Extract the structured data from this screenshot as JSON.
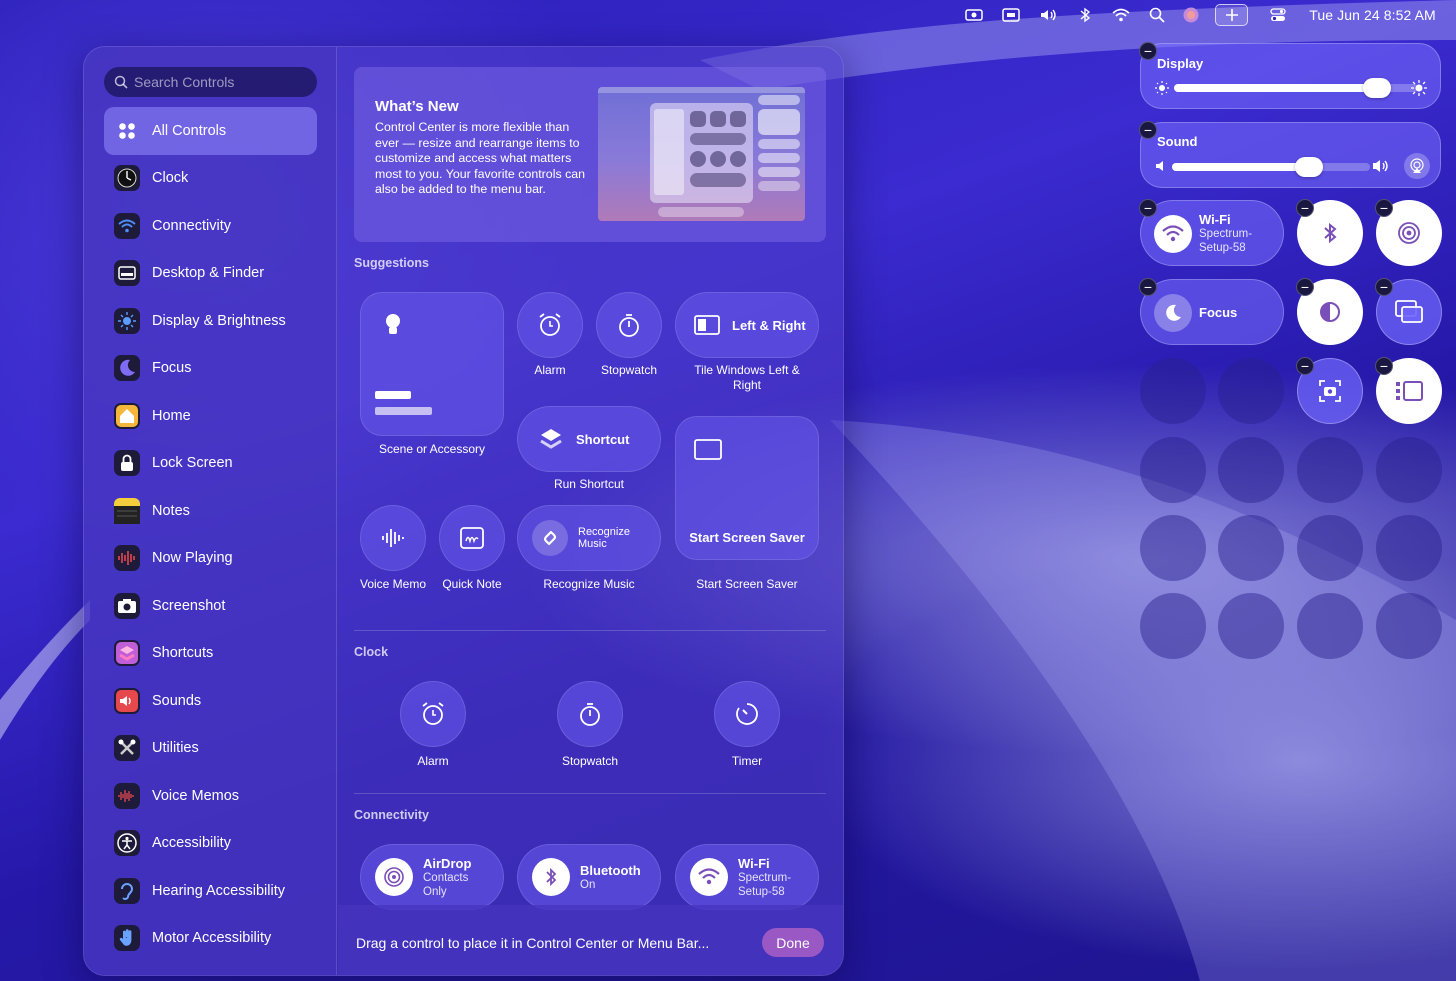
{
  "menubar": {
    "clock": "Tue Jun 24  8:52 AM",
    "icons": [
      "screen-record-icon",
      "keyboard-icon",
      "volume-icon",
      "bluetooth-icon",
      "wifi-icon",
      "search-icon",
      "siri-icon",
      "plus-icon",
      "control-center-icon"
    ]
  },
  "sidebar": {
    "search_placeholder": "Search Controls",
    "items": [
      {
        "label": "All Controls",
        "icon": "grid-icon"
      },
      {
        "label": "Clock",
        "icon": "clock-icon"
      },
      {
        "label": "Connectivity",
        "icon": "wifi-icon"
      },
      {
        "label": "Desktop & Finder",
        "icon": "desktop-icon"
      },
      {
        "label": "Display & Brightness",
        "icon": "sun-icon"
      },
      {
        "label": "Focus",
        "icon": "moon-icon"
      },
      {
        "label": "Home",
        "icon": "home-icon"
      },
      {
        "label": "Lock Screen",
        "icon": "lock-icon"
      },
      {
        "label": "Notes",
        "icon": "notes-icon"
      },
      {
        "label": "Now Playing",
        "icon": "waveform-icon"
      },
      {
        "label": "Screenshot",
        "icon": "camera-icon"
      },
      {
        "label": "Shortcuts",
        "icon": "shortcuts-icon"
      },
      {
        "label": "Sounds",
        "icon": "speaker-icon"
      },
      {
        "label": "Utilities",
        "icon": "tools-icon"
      },
      {
        "label": "Voice Memos",
        "icon": "voice-memo-icon"
      },
      {
        "label": "Accessibility",
        "icon": "accessibility-icon"
      },
      {
        "label": "Hearing Accessibility",
        "icon": "ear-icon"
      },
      {
        "label": "Motor Accessibility",
        "icon": "hand-icon"
      }
    ]
  },
  "whats_new": {
    "title": "What’s New",
    "body": "Control Center is more flexible than ever — resize and rearrange items to customize and access what matters most to you. Your favorite controls can also be added to the menu bar."
  },
  "suggestions": {
    "title": "Suggestions",
    "scene_label": "Scene or Accessory",
    "alarm_label": "Alarm",
    "stopwatch_label": "Stopwatch",
    "left_right_title": "Left & Right",
    "left_right_label": "Tile Windows Left & Right",
    "shortcut_title": "Shortcut",
    "shortcut_label": "Run Shortcut",
    "screensaver_title": "Start Screen Saver",
    "screensaver_label": "Start Screen Saver",
    "voice_memo_label": "Voice Memo",
    "quick_note_label": "Quick Note",
    "recognize_title": "Recognize Music",
    "recognize_label": "Recognize Music"
  },
  "clock_section": {
    "title": "Clock",
    "alarm": "Alarm",
    "stopwatch": "Stopwatch",
    "timer": "Timer"
  },
  "connectivity_section": {
    "title": "Connectivity",
    "airdrop_title": "AirDrop",
    "airdrop_sub": "Contacts Only",
    "bluetooth_title": "Bluetooth",
    "bluetooth_sub": "On",
    "wifi_title": "Wi-Fi",
    "wifi_sub": "Spectrum-Setup-58"
  },
  "footer": {
    "hint": "Drag a control to place it in Control Center or Menu Bar...",
    "done": "Done"
  },
  "control_center": {
    "display_title": "Display",
    "display_level": 0.83,
    "sound_title": "Sound",
    "sound_level": 0.69,
    "wifi_title": "Wi-Fi",
    "wifi_sub": "Spectrum-Setup-58",
    "focus_title": "Focus"
  },
  "colors": {
    "accent": "#9a58c4",
    "panel": "#4f3ec8",
    "wall": "#2a1fb8"
  }
}
